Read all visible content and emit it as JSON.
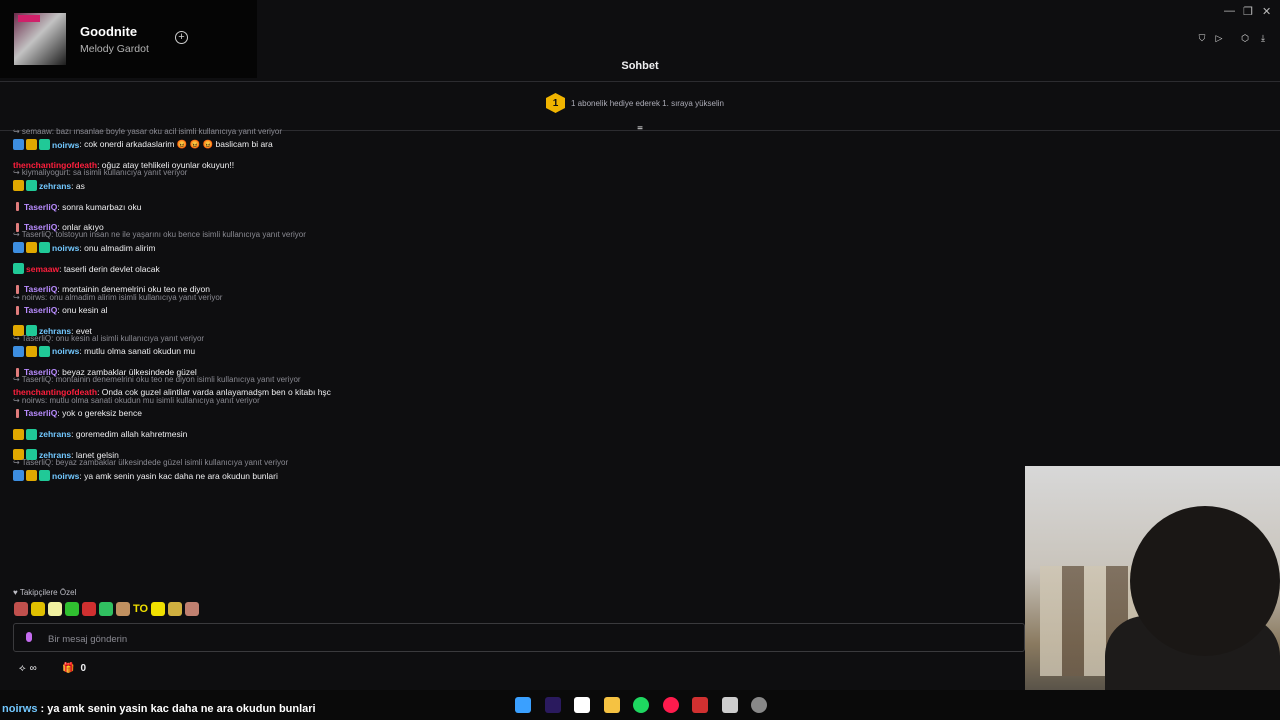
{
  "now_playing": {
    "title": "Goodnite",
    "artist": "Melody Gardot"
  },
  "window_controls": [
    "—",
    "❐",
    "✕"
  ],
  "chat": {
    "title": "Sohbet",
    "sub_banner": {
      "rank": "1",
      "text": "1 abonelik hediye ederek 1. sıraya yükselin"
    },
    "messages": [
      {
        "reply": "semaaw: bazı ınsanlae boyle yasar oku acil isimli kullanıcıya yanıt veriyor",
        "badges": [
          "mod",
          "crown",
          "sub"
        ],
        "user": "noirws",
        "color": "#72c8ff",
        "text": ": cok onerdi arkadaslarim 😡 😡 😡  baslicam bi ara"
      },
      {
        "reply": "",
        "badges": [],
        "user": "thenchantingofdeath",
        "color": "#ff1f3d",
        "text": ": oğuz atay tehlikeli oyunlar okuyun!!"
      },
      {
        "reply": "kiymaliyogurt: sa isimli kullanıcıya yanıt veriyor",
        "badges": [
          "crown",
          "sub"
        ],
        "user": "zehrans",
        "color": "#72c8ff",
        "text": ": as"
      },
      {
        "reply": "",
        "badges": [
          "drink"
        ],
        "user": "TaserliQ",
        "color": "#b98cff",
        "text": ": sonra kumarbazı oku"
      },
      {
        "reply": "",
        "badges": [
          "drink"
        ],
        "user": "TaserliQ",
        "color": "#b98cff",
        "text": ": onlar akıyo"
      },
      {
        "reply": "TaserliQ: tolstoyun insan ne ile yaşarını oku bence isimli kullanıcıya yanıt veriyor",
        "badges": [
          "mod",
          "crown",
          "sub"
        ],
        "user": "noirws",
        "color": "#72c8ff",
        "text": ": onu almadim alirim"
      },
      {
        "reply": "",
        "badges": [
          "sub"
        ],
        "user": "semaaw",
        "color": "#ff1f3d",
        "text": ": taserli derin devlet olacak"
      },
      {
        "reply": "",
        "badges": [
          "drink"
        ],
        "user": "TaserliQ",
        "color": "#b98cff",
        "text": ": montainin denemelrini oku teo ne diyon"
      },
      {
        "reply": "noirws: onu almadim alirim isimli kullanıcıya yanıt veriyor",
        "badges": [
          "drink"
        ],
        "user": "TaserliQ",
        "color": "#b98cff",
        "text": ": onu kesin al"
      },
      {
        "reply": "",
        "badges": [
          "crown",
          "sub"
        ],
        "user": "zehrans",
        "color": "#72c8ff",
        "text": ": evet"
      },
      {
        "reply": "TaserliQ: onu kesin al isimli kullanıcıya yanıt veriyor",
        "badges": [
          "mod",
          "crown",
          "sub"
        ],
        "user": "noirws",
        "color": "#72c8ff",
        "text": ": mutlu olma sanati okudun mu"
      },
      {
        "reply": "",
        "badges": [
          "drink"
        ],
        "user": "TaserliQ",
        "color": "#b98cff",
        "text": ": beyaz zambaklar ülkesindede güzel"
      },
      {
        "reply": "TaserliQ: montainin denemelrini oku teo ne diyon isimli kullanıcıya yanıt veriyor",
        "badges": [],
        "user": "thenchantingofdeath",
        "color": "#ff1f3d",
        "text": ": Onda cok guzel alintilar varda anlayamadşm ben o kitabı hşc"
      },
      {
        "reply": "noirws: mutlu olma sanati okudun mu isimli kullanıcıya yanıt veriyor",
        "badges": [
          "drink"
        ],
        "user": "TaserliQ",
        "color": "#b98cff",
        "text": ": yok o gereksiz bence"
      },
      {
        "reply": "",
        "badges": [
          "crown",
          "sub"
        ],
        "user": "zehrans",
        "color": "#72c8ff",
        "text": ": goremedim allah kahretmesin"
      },
      {
        "reply": "",
        "badges": [
          "crown",
          "sub"
        ],
        "user": "zehrans",
        "color": "#72c8ff",
        "text": ": lanet gelsin"
      },
      {
        "reply": "TaserliQ: beyaz zambaklar ülkesindede güzel isimli kullanıcıya yanıt veriyor",
        "badges": [
          "mod",
          "crown",
          "sub"
        ],
        "user": "noirws",
        "color": "#72c8ff",
        "text": ": ya amk senin yasin kac daha ne ara okudun bunlari"
      }
    ],
    "emote_section_label": "♥ Takipçilere Özel",
    "emote_colors": [
      "#c0504d",
      "#e0c000",
      "#f0f0a0",
      "#30c030",
      "#d03030",
      "#30c060",
      "#c09060",
      "#f0e000",
      "#d0b040",
      "#c08070"
    ],
    "emote_text_to": "TO",
    "input_placeholder": "Bir mesaj gönderin",
    "points_value": "∞",
    "gift_count": "0"
  },
  "ticker": {
    "user": "noirws",
    "text": " : ya amk senin yasin kac daha ne ara okudun bunlari"
  },
  "taskbar_icons": [
    {
      "name": "windows-start-icon",
      "color": "#3aa0ff"
    },
    {
      "name": "premiere-pro-icon",
      "color": "#2a1a5e"
    },
    {
      "name": "capcut-icon",
      "color": "#ffffff"
    },
    {
      "name": "file-explorer-icon",
      "color": "#f5c242"
    },
    {
      "name": "spotify-icon",
      "color": "#1ed760"
    },
    {
      "name": "opera-gx-icon",
      "color": "#ff1b4d"
    },
    {
      "name": "voicemod-icon",
      "color": "#d03030"
    },
    {
      "name": "game-icon",
      "color": "#cccccc"
    },
    {
      "name": "obs-icon",
      "color": "#888888"
    }
  ]
}
